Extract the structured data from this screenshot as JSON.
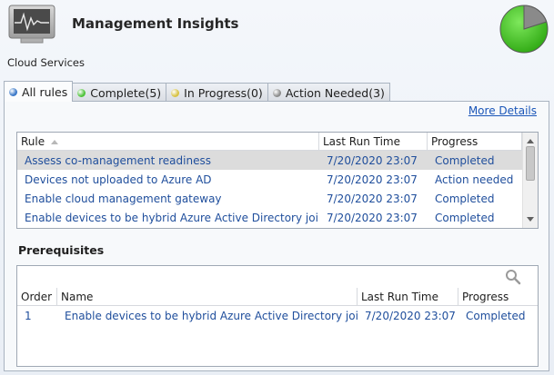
{
  "header": {
    "title": "Management Insights",
    "subtitle": "Cloud Services"
  },
  "tabs": [
    {
      "label": "All rules",
      "dot_color": "#3a78c8",
      "active": true
    },
    {
      "label": "Complete(5)",
      "dot_color": "#4fc33a",
      "active": false
    },
    {
      "label": "In Progress(0)",
      "dot_color": "#d8c243",
      "active": false
    },
    {
      "label": "Action Needed(3)",
      "dot_color": "#8c8c8c",
      "active": false
    }
  ],
  "more_details": "More Details",
  "rules_table": {
    "columns": [
      "Rule",
      "Last Run Time",
      "Progress"
    ],
    "sort_indicator": "sort-ascending-icon",
    "rows": [
      {
        "rule": "Assess co-management readiness",
        "time": "7/20/2020 23:07",
        "progress": "Completed"
      },
      {
        "rule": "Devices not uploaded to Azure AD",
        "time": "7/20/2020 23:07",
        "progress": "Action needed"
      },
      {
        "rule": "Enable cloud management gateway",
        "time": "7/20/2020 23:07",
        "progress": "Completed"
      },
      {
        "rule": "Enable devices to be hybrid Azure Active Directory joined",
        "time": "7/20/2020 23:07",
        "progress": "Completed"
      }
    ]
  },
  "prerequisites": {
    "title": "Prerequisites",
    "columns": [
      "Order",
      "Name",
      "Last Run Time",
      "Progress"
    ],
    "rows": [
      {
        "order": "1",
        "name": "Enable devices to be hybrid Azure Active Directory joined",
        "time": "7/20/2020 23:07",
        "progress": "Completed"
      }
    ]
  },
  "colors": {
    "link": "#1a56b8",
    "row_text": "#1f4e9c",
    "pie_complete": "#43c61f",
    "pie_remaining": "#8a8a8a"
  }
}
